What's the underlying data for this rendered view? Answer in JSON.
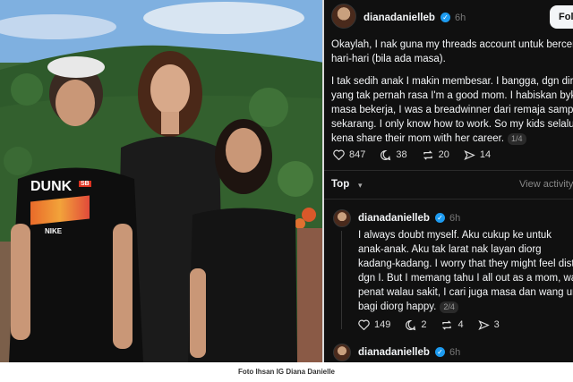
{
  "photo": {
    "shirt_text": "DUNK",
    "shirt_tag": "SB",
    "shirt_sub": "NIKE"
  },
  "threads": {
    "post": {
      "username": "dianadanielleb",
      "time": "6h",
      "follow_label": "Follow",
      "lines_p1": [
        "Okaylah, I nak guna my threads account untuk bercerita",
        "hari-hari (bila ada masa)."
      ],
      "lines_p2": [
        "I tak sedih anak I makin membesar. I bangga, dgn diri I",
        "yang tak pernah rasa I'm a good mom. I habiskan byk",
        "masa bekerja, I was a breadwinner dari remaja sampai",
        "sekarang. I only know how to work. So my kids selalu",
        "kena share their mom with her career."
      ],
      "page": "1/4",
      "likes": "847",
      "comments": "38",
      "reposts": "20",
      "shares": "14"
    },
    "sort": {
      "label": "Top",
      "view_activity": "View activity"
    },
    "reply": {
      "username": "dianadanielleb",
      "time": "6h",
      "lines": [
        "I always doubt myself. Aku cukup ke untuk",
        "anak-anak. Aku tak larat nak layan diorg",
        "kadang-kadang. I worry that they might feel distant",
        "dgn I. But I memang tahu I all out as a mom, walau",
        "penat walau sakit, I cari juga masa dan wang untuk",
        "bagi diorg happy."
      ],
      "page": "2/4",
      "likes": "149",
      "comments": "2",
      "reposts": "4",
      "shares": "3"
    },
    "reply2": {
      "username": "dianadanielleb",
      "time": "6h"
    }
  },
  "caption": "Foto Ihsan IG Diana Danielle",
  "colors": {
    "panel_bg": "#101010",
    "text": "#f3f5f7",
    "verified": "#1d9bf0",
    "muted": "#777777"
  },
  "icons": [
    "heart-icon",
    "comment-icon",
    "repost-icon",
    "share-icon",
    "verified-icon",
    "chevron-down-icon"
  ]
}
